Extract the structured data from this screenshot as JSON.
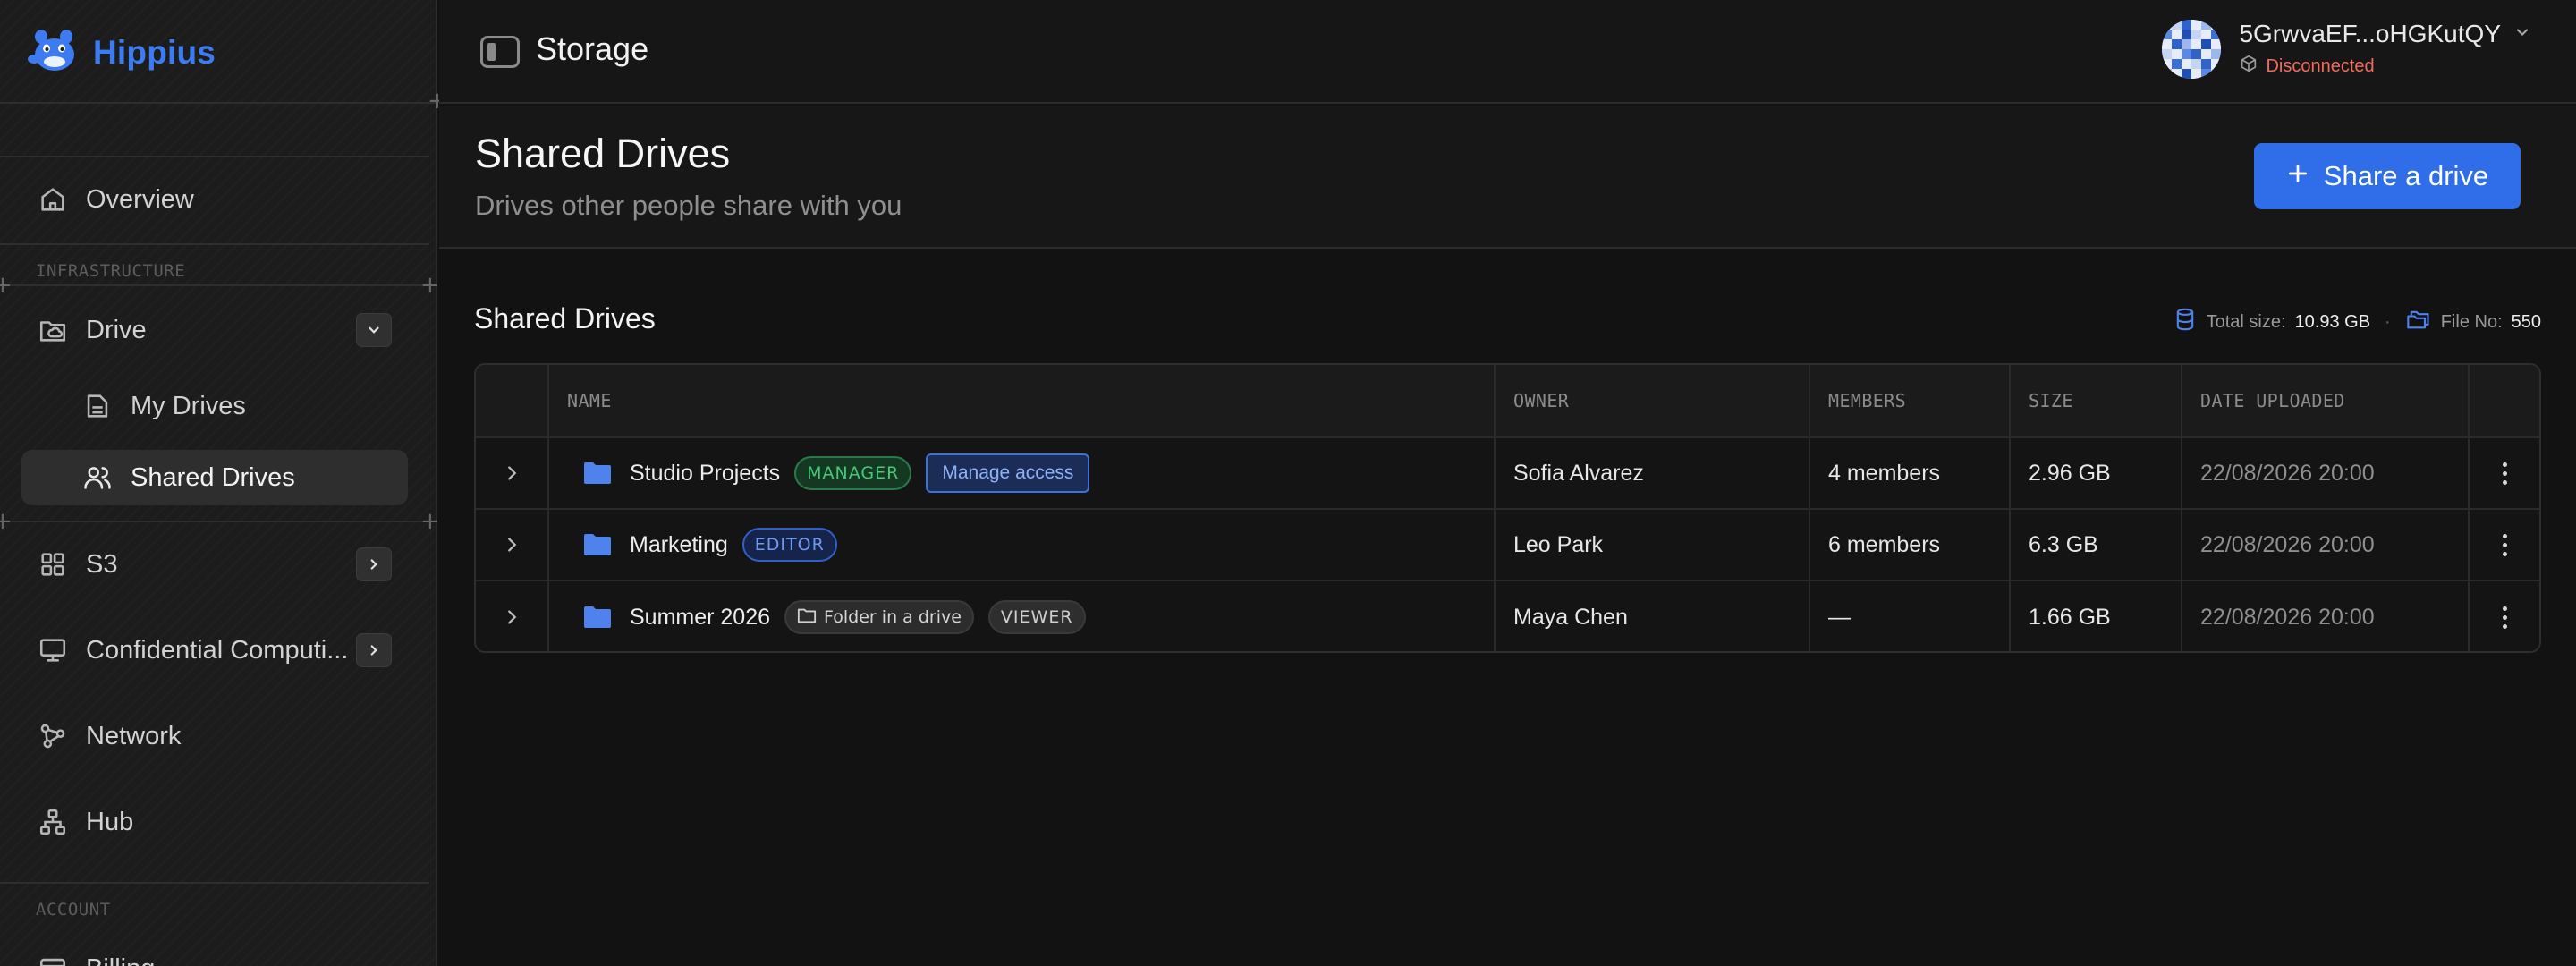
{
  "app": {
    "brand": "Hippius",
    "topbar_title": "Storage"
  },
  "account": {
    "name": "5GrwvaEF...oHGKutQY",
    "status": "Disconnected",
    "status_color": "#f26b5b"
  },
  "sidebar": {
    "overview": "Overview",
    "section_infrastructure": "INFRASTRUCTURE",
    "drive": "Drive",
    "my_drives": "My Drives",
    "shared_drives": "Shared Drives",
    "s3": "S3",
    "confidential": "Confidential Computi...",
    "network": "Network",
    "hub": "Hub",
    "section_account": "ACCOUNT",
    "billing": "Billing"
  },
  "page": {
    "title": "Shared Drives",
    "subtitle": "Drives other people share with you",
    "share_button": "Share a drive"
  },
  "section": {
    "title": "Shared Drives",
    "total_size_label": "Total size:",
    "total_size": "10.93 GB",
    "file_no_label": "File No:",
    "file_no": "550"
  },
  "table": {
    "headers": [
      "NAME",
      "OWNER",
      "MEMBERS",
      "SIZE",
      "DATE UPLOADED"
    ],
    "rows": [
      {
        "name": "Studio Projects",
        "role": "MANAGER",
        "action": "Manage access",
        "owner": "Sofia Alvarez",
        "members": "4 members",
        "size": "2.96 GB",
        "date": "22/08/2026 20:00"
      },
      {
        "name": "Marketing",
        "role": "EDITOR",
        "owner": "Leo Park",
        "members": "6 members",
        "size": "6.3 GB",
        "date": "22/08/2026 20:00"
      },
      {
        "name": "Summer 2026",
        "tag": "Folder in a drive",
        "role": "VIEWER",
        "owner": "Maya Chen",
        "members": "—",
        "size": "1.66 GB",
        "date": "22/08/2026 20:00"
      }
    ]
  },
  "colors": {
    "accent": "#2f6ee8",
    "brand": "#3d7bf2",
    "folder": "#4f82ec"
  }
}
